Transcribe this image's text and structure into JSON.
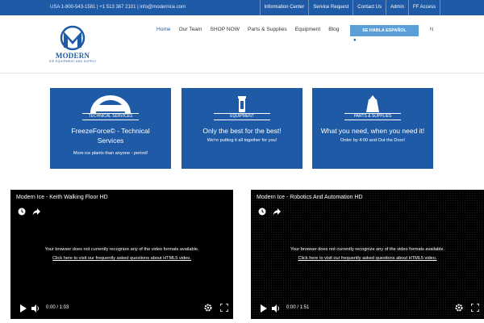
{
  "topbar": {
    "contact": "USA 1-800-543-1581 | +1 513 367 2101  |  info@modernice.com",
    "links": [
      "Information Center",
      "Service Request",
      "Contact Us",
      "Admin",
      "FF Access"
    ]
  },
  "logo": {
    "brand": "MODERN",
    "tagline": "ICE EQUIPMENT AND SUPPLY"
  },
  "nav": {
    "items": [
      "Home",
      "Our Team",
      "SHOP NOW",
      "Parts & Supplies",
      "Equipment",
      "Blog"
    ]
  },
  "espanol_label": "SE HABLA ESPAÑOL",
  "lang_label": "N",
  "cards": [
    {
      "icon": "freezeforce-logo-icon",
      "badge": "FREEZE FORCE",
      "caption": "TECHNICAL SERVICES",
      "title": "FreezeForce© - Technical Services",
      "subtitle": "More ice plants than anyone - period!"
    },
    {
      "icon": "equipment-icon",
      "caption": "EQUIPMENT",
      "title": "Only the best for the best!",
      "subtitle": "We're putting it all together for you!"
    },
    {
      "icon": "ice-bag-icon",
      "caption": "PARTS & SUPPLIES",
      "title": "What you need, when you need it!",
      "subtitle": "Order by 4:00 and Out the Door!"
    }
  ],
  "videos": [
    {
      "title": "Modern Ice - Keith Walking Floor HD",
      "message": "Your browser does not currently recognize any of the video formats available.",
      "link": "Click here to visit our frequently asked questions about HTML5 video.",
      "time": "0:00  /  1:03"
    },
    {
      "title": "Modern Ice - Robotics And Automation HD",
      "message": "Your browser does not currently recognize any of the video formats available.",
      "link": "Click here to visit our frequently asked questions about HTML5 video.",
      "time": "0:00  /  1:51"
    }
  ],
  "colors": {
    "brand_blue": "#1f5aa6",
    "button_blue": "#5a9fd8"
  }
}
